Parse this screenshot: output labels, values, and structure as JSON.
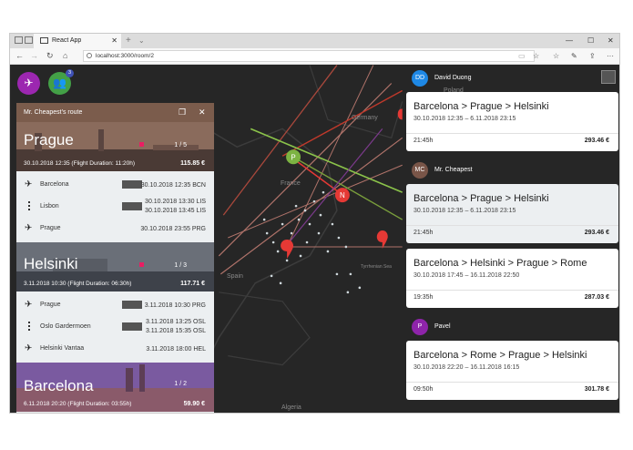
{
  "browser": {
    "tab_title": "React App",
    "url": "localhost:3000/room/2"
  },
  "fabs": {
    "flights_icon": "airplane-icon",
    "group_icon": "group-icon",
    "group_badge": "3"
  },
  "map": {
    "labels": [
      "Poland",
      "Germany",
      "France",
      "Spain",
      "Algeria",
      "Tyrrhenian Sea"
    ],
    "marker_p": "P",
    "marker_n": "N"
  },
  "left_panel": {
    "title": "Mr. Cheapest's route",
    "cities": [
      {
        "name": "Prague",
        "subtitle": "30.10.2018 12:35 (Flight Duration: 11:20h)",
        "price": "115.85 €",
        "page": "1 / 5"
      },
      {
        "name": "Helsinki",
        "subtitle": "3.11.2018 10:30 (Flight Duration: 06:30h)",
        "price": "117.71 €",
        "page": "1 / 3"
      },
      {
        "name": "Barcelona",
        "subtitle": "6.11.2018 20:20 (Flight Duration: 03:55h)",
        "price": "59.90 €",
        "page": "1 / 2"
      }
    ],
    "legs": [
      {
        "from": "Barcelona",
        "from_time": "30.10.2018 12:35 BCN",
        "via": "Lisbon",
        "via_time1": "30.10.2018 13:30 LIS",
        "via_time2": "30.10.2018 13:45 LIS",
        "to": "Prague",
        "to_time": "30.10.2018 23:55 PRG"
      },
      {
        "from": "Prague",
        "from_time": "3.11.2018 10:30 PRG",
        "via": "Oslo Gardermoen",
        "via_time1": "3.11.2018 13:25 OSL",
        "via_time2": "3.11.2018 15:35 OSL",
        "to": "Helsinki Vantaa",
        "to_time": "3.11.2018 18:00 HEL"
      }
    ]
  },
  "right_panel": {
    "users": [
      {
        "initials": "DD",
        "name": "David Duong",
        "color": "#1e88e5",
        "cards": [
          {
            "route": "Barcelona > Prague > Helsinki",
            "dates": "30.10.2018 12:35 – 6.11.2018 23:15",
            "duration": "21:45h",
            "price": "293.46 €"
          }
        ]
      },
      {
        "initials": "MC",
        "name": "Mr. Cheapest",
        "color": "#795548",
        "cards": [
          {
            "route": "Barcelona > Prague > Helsinki",
            "dates": "30.10.2018 12:35 – 6.11.2018 23:15",
            "duration": "21:45h",
            "price": "293.46 €"
          },
          {
            "route": "Barcelona > Helsinki > Prague > Rome",
            "dates": "30.10.2018 17:45 – 16.11.2018 22:50",
            "duration": "19:35h",
            "price": "287.03 €"
          }
        ]
      },
      {
        "initials": "P",
        "name": "Pavel",
        "color": "#8e24aa",
        "cards": [
          {
            "route": "Barcelona > Rome > Prague > Helsinki",
            "dates": "30.10.2018 22:20 – 16.11.2018 16:15",
            "duration": "09:50h",
            "price": "301.78 €"
          }
        ]
      }
    ]
  },
  "colors": {
    "fab_flights": "#9c27b0",
    "fab_group": "#43a047",
    "marker_red": "#e53935",
    "marker_green": "#7cb342"
  }
}
